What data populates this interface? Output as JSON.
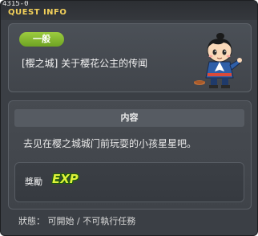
{
  "window": {
    "quest_id": "4315-0",
    "title": "QUEST INFO"
  },
  "header": {
    "tag_label": "一般",
    "quest_title": "[樱之城] 关于樱花公主的传闻",
    "npc_icon": "npc-boy-portrait-icon"
  },
  "content": {
    "section_label": "内容",
    "description": "去见在樱之城城门前玩耍的小孩星星吧。"
  },
  "reward": {
    "label": "獎勵",
    "exp_label": "EXP"
  },
  "status": {
    "text": "狀態： 可開始 / 不可執行任務"
  },
  "colors": {
    "title": "#f2d05a",
    "tag_green": "#8cc13a",
    "exp": "#dff23a",
    "window_bg": "#3b3f45"
  }
}
